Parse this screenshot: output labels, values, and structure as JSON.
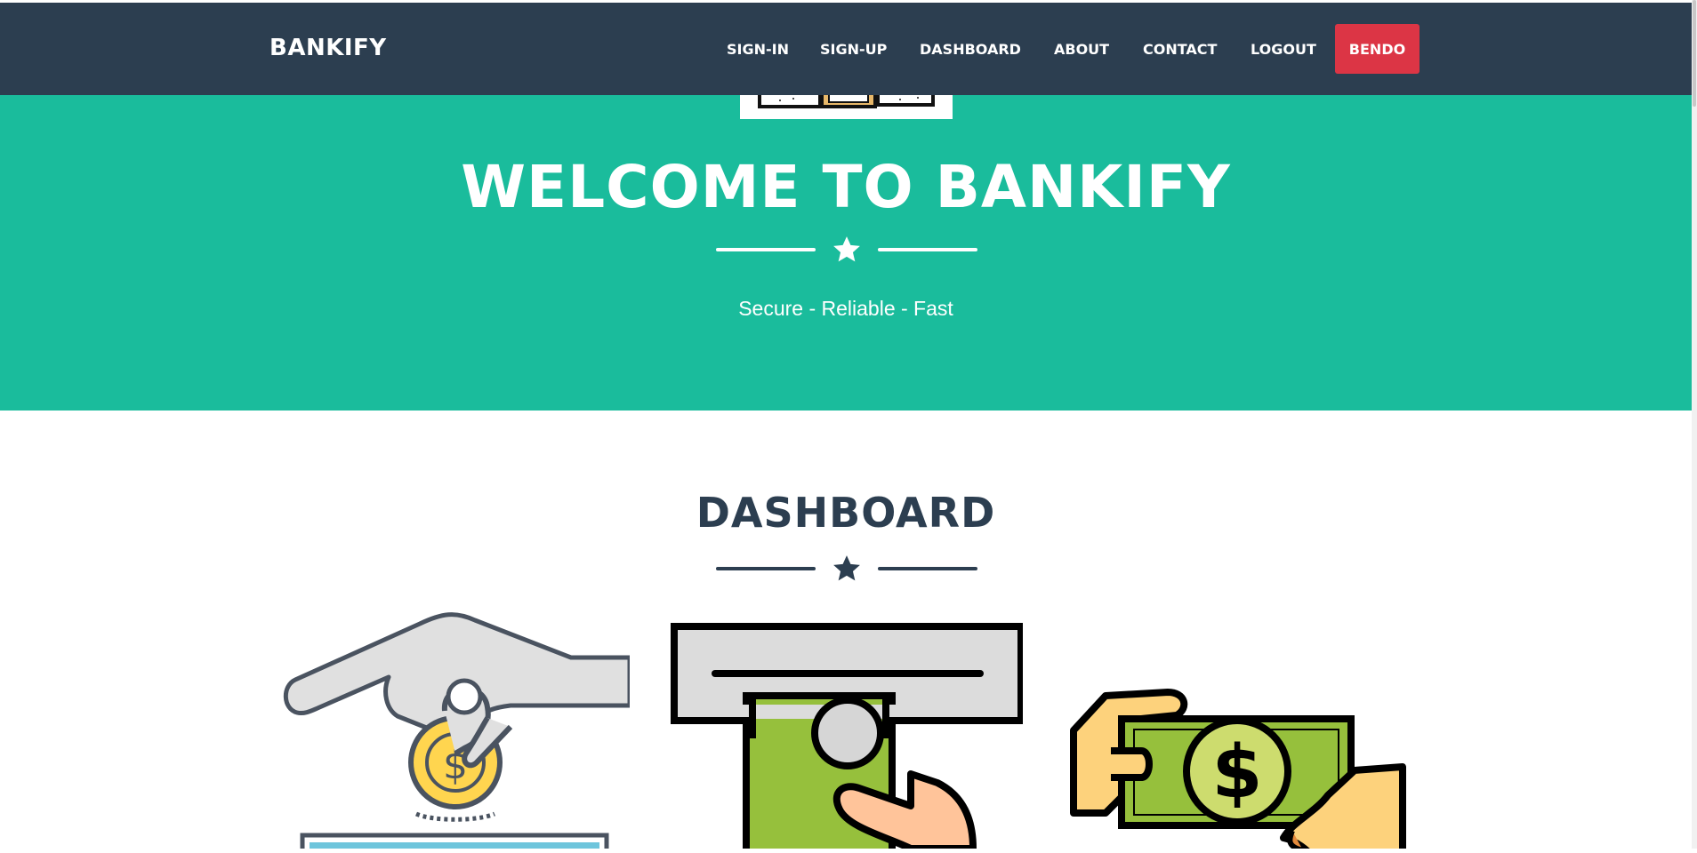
{
  "navbar": {
    "brand": "BANKIFY",
    "items": [
      {
        "label": "SIGN-IN"
      },
      {
        "label": "SIGN-UP"
      },
      {
        "label": "DASHBOARD"
      },
      {
        "label": "ABOUT"
      },
      {
        "label": "CONTACT"
      },
      {
        "label": "LOGOUT"
      }
    ],
    "user": "BENDO"
  },
  "hero": {
    "title": "WELCOME TO BANKIFY",
    "subtitle": "Secure - Reliable - Fast",
    "divider_icon": "star-icon"
  },
  "dashboard": {
    "title": "DASHBOARD",
    "divider_icon": "star-icon",
    "cards": [
      {
        "icon": "deposit-coin-icon"
      },
      {
        "icon": "atm-withdraw-icon"
      },
      {
        "icon": "money-transfer-icon"
      }
    ]
  },
  "colors": {
    "navbar_bg": "#2c3e50",
    "hero_bg": "#1abc9c",
    "accent_red": "#dc3545",
    "heading_dark": "#2c3e50"
  }
}
